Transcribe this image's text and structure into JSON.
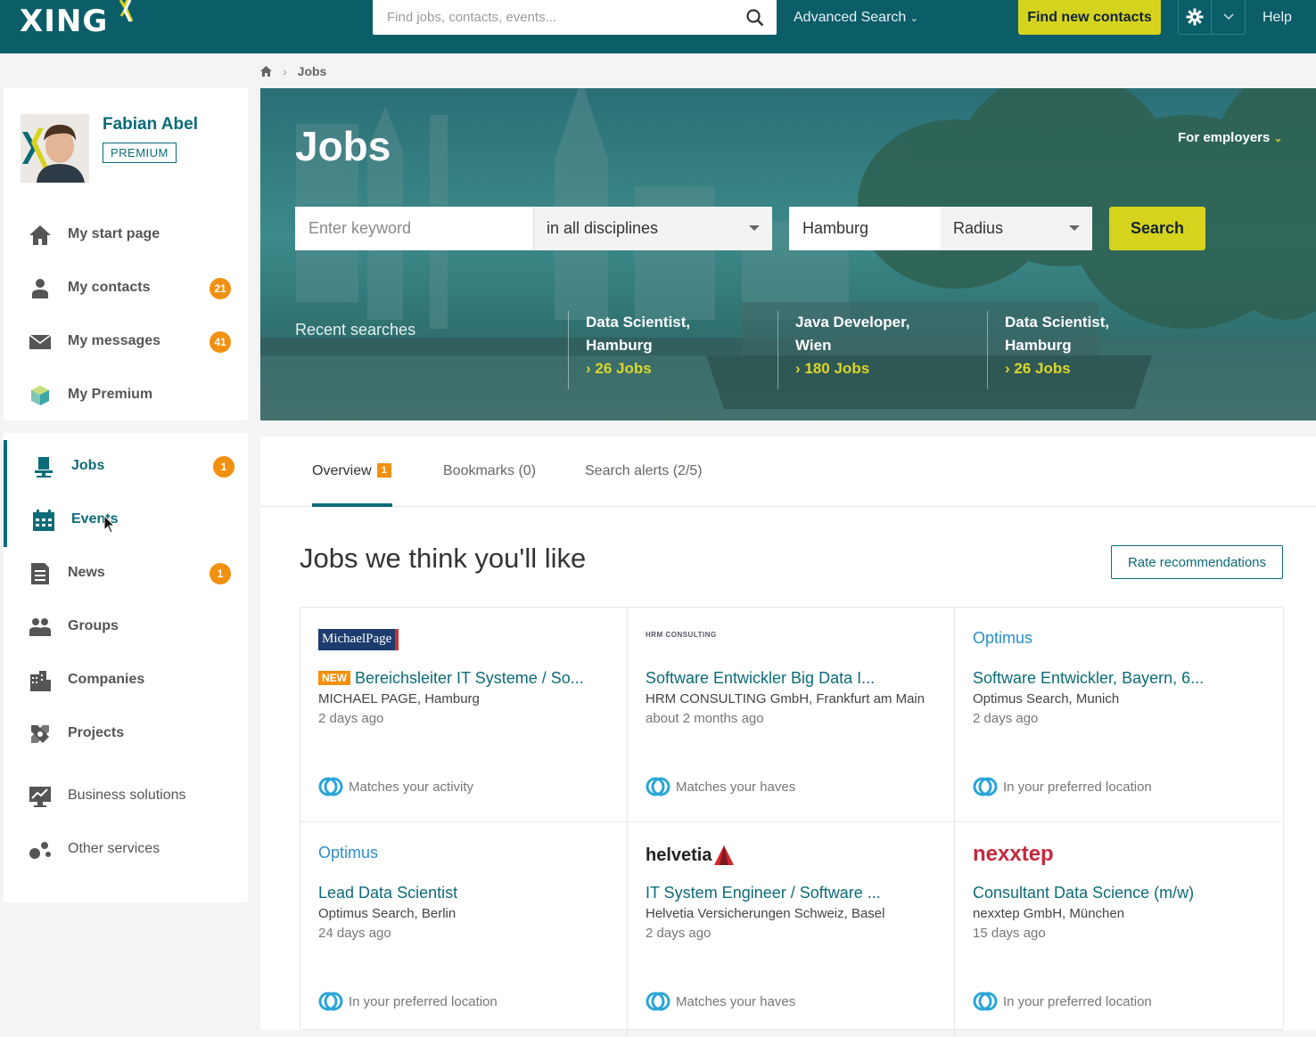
{
  "topbar": {
    "logo": "XING",
    "search_placeholder": "Find jobs, contacts, events...",
    "advanced_search": "Advanced Search",
    "find_contacts": "Find new contacts",
    "help": "Help",
    "colors": {
      "bar": "#0b5d68",
      "accent": "#d6d31e"
    }
  },
  "breadcrumb": {
    "current": "Jobs"
  },
  "profile": {
    "name": "Fabian Abel",
    "badge": "PREMIUM"
  },
  "sidebar": {
    "items": [
      {
        "label": "My start page",
        "icon": "home-icon",
        "badge": ""
      },
      {
        "label": "My contacts",
        "icon": "contacts-icon",
        "badge": "21"
      },
      {
        "label": "My messages",
        "icon": "envelope-icon",
        "badge": "41"
      },
      {
        "label": "My Premium",
        "icon": "premium-cube-icon",
        "badge": ""
      },
      {
        "label": "Jobs",
        "icon": "jobs-chair-icon",
        "badge": "1"
      },
      {
        "label": "Events",
        "icon": "calendar-icon",
        "badge": ""
      },
      {
        "label": "News",
        "icon": "news-icon",
        "badge": "1"
      },
      {
        "label": "Groups",
        "icon": "groups-icon",
        "badge": ""
      },
      {
        "label": "Companies",
        "icon": "companies-icon",
        "badge": ""
      },
      {
        "label": "Projects",
        "icon": "projects-icon",
        "badge": ""
      },
      {
        "label": "Business solutions",
        "icon": "business-chart-icon",
        "badge": ""
      },
      {
        "label": "Other services",
        "icon": "other-services-icon",
        "badge": ""
      }
    ]
  },
  "hero": {
    "title": "Jobs",
    "for_employers": "For employers",
    "keyword_placeholder": "Enter keyword",
    "discipline": "in all disciplines",
    "city": "Hamburg",
    "radius": "Radius",
    "search_button": "Search",
    "recent_label": "Recent searches",
    "recent": [
      {
        "line1": "Data Scientist,",
        "line2": "Hamburg",
        "count": "26 Jobs"
      },
      {
        "line1": "Java Developer,",
        "line2": "Wien",
        "count": "180 Jobs"
      },
      {
        "line1": "Data Scientist,",
        "line2": "Hamburg",
        "count": "26 Jobs"
      }
    ]
  },
  "tabs": [
    {
      "label": "Overview",
      "badge": "1"
    },
    {
      "label": "Bookmarks (0)",
      "badge": ""
    },
    {
      "label": "Search alerts (2/5)",
      "badge": ""
    }
  ],
  "recommendations": {
    "title": "Jobs we think you'll like",
    "rate_button": "Rate recommendations",
    "jobs": [
      {
        "logo": "MichaelPage",
        "new": "NEW",
        "title": "Bereichsleiter IT Systeme / So...",
        "company": "MICHAEL PAGE, Hamburg",
        "age": "2 days ago",
        "reason": "Matches your activity"
      },
      {
        "logo": "HRM CONSULTING",
        "new": "",
        "title": "Software Entwickler Big Data I...",
        "company": "HRM CONSULTING GmbH, Frankfurt am Main",
        "age": "about 2 months ago",
        "reason": "Matches your haves"
      },
      {
        "logo": "Optimus",
        "new": "",
        "title": "Software Entwickler, Bayern, 6...",
        "company": "Optimus Search, Munich",
        "age": "2 days ago",
        "reason": "In your preferred location"
      },
      {
        "logo": "Optimus",
        "new": "",
        "title": "Lead Data Scientist",
        "company": "Optimus Search, Berlin",
        "age": "24 days ago",
        "reason": "In your preferred location"
      },
      {
        "logo": "helvetia",
        "new": "",
        "title": "IT System Engineer / Software ...",
        "company": "Helvetia Versicherungen Schweiz, Basel",
        "age": "2 days ago",
        "reason": "Matches your haves"
      },
      {
        "logo": "nexxtep",
        "new": "",
        "title": "Consultant Data Science (m/w)",
        "company": "nexxtep GmbH, München",
        "age": "15 days ago",
        "reason": "In your preferred location"
      }
    ]
  }
}
